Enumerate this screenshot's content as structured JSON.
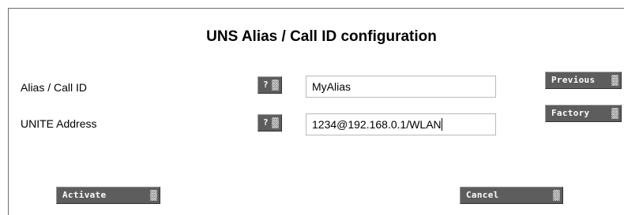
{
  "page": {
    "title": "UNS Alias / Call ID configuration"
  },
  "fields": [
    {
      "label": "Alias / Call ID",
      "help_label": "?",
      "value": "MyAlias"
    },
    {
      "label": "UNITE Address",
      "help_label": "?",
      "value": "1234@192.168.0.1/WLAN"
    }
  ],
  "buttons": {
    "previous": "Previous",
    "factory": "Factory",
    "activate": "Activate",
    "cancel": "Cancel"
  },
  "colors": {
    "button_bg": "#5d5d5d",
    "button_text": "#ffffff",
    "input_border": "#b9b9b9"
  }
}
